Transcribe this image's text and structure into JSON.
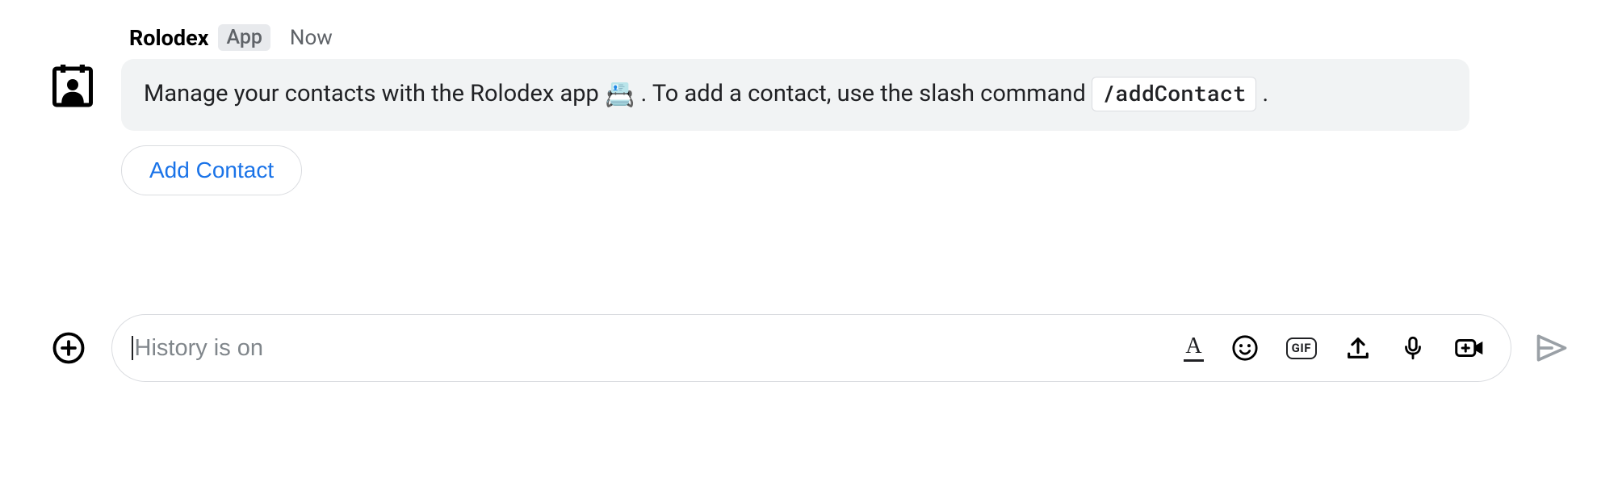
{
  "message": {
    "author_name": "Rolodex",
    "author_badge": "App",
    "timestamp": "Now",
    "body_prefix": "Manage your contacts with the Rolodex app ",
    "emoji": "📇",
    "body_mid": ". To add a contact, use the slash command ",
    "slash_command": "/addContact",
    "body_suffix": " ."
  },
  "action": {
    "add_contact_label": "Add Contact"
  },
  "composer": {
    "placeholder": "History is on"
  }
}
